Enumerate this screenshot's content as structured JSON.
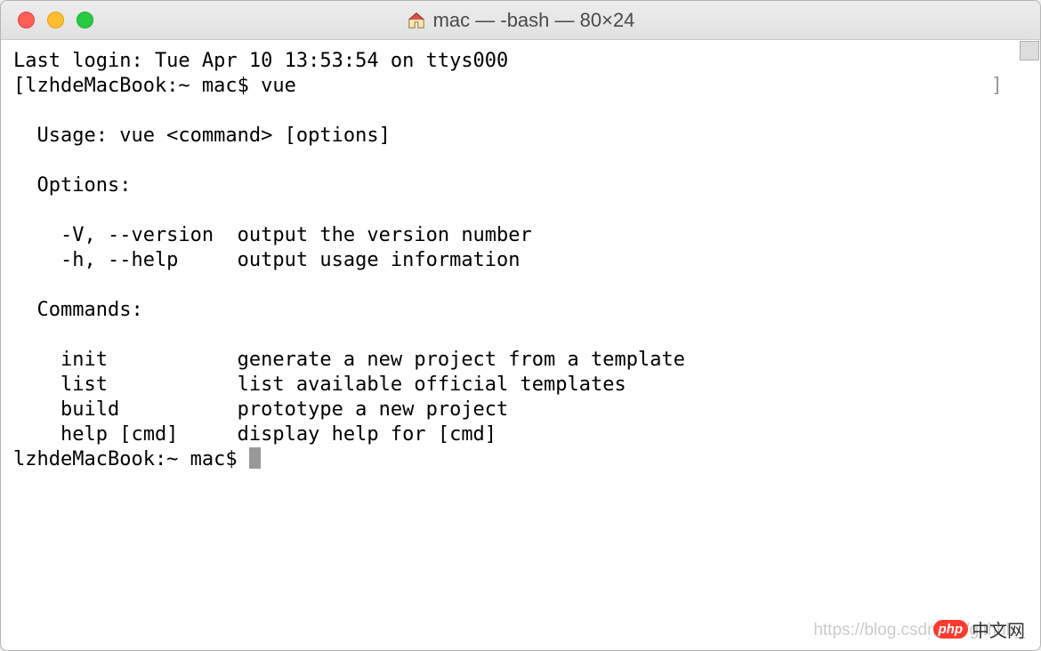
{
  "title": "mac — -bash — 80×24",
  "lastLogin": "Last login: Tue Apr 10 13:53:54 on ttys000",
  "prompt1_open": "[",
  "prompt1_body": "lzhdeMacBook:~ mac$ vue",
  "prompt1_close": "]",
  "usage": "  Usage: vue <command> [options]",
  "optionsHeader": "  Options:",
  "options": [
    "    -V, --version  output the version number",
    "    -h, --help     output usage information"
  ],
  "commandsHeader": "  Commands:",
  "commands": [
    "    init           generate a new project from a template",
    "    list           list available official templates",
    "    build          prototype a new project",
    "    help [cmd]     display help for [cmd]"
  ],
  "prompt2": "lzhdeMacBook:~ mac$ ",
  "watermark": "https://blog.csdn.net/github_",
  "logoText": "中文网",
  "phpBadge": "php"
}
